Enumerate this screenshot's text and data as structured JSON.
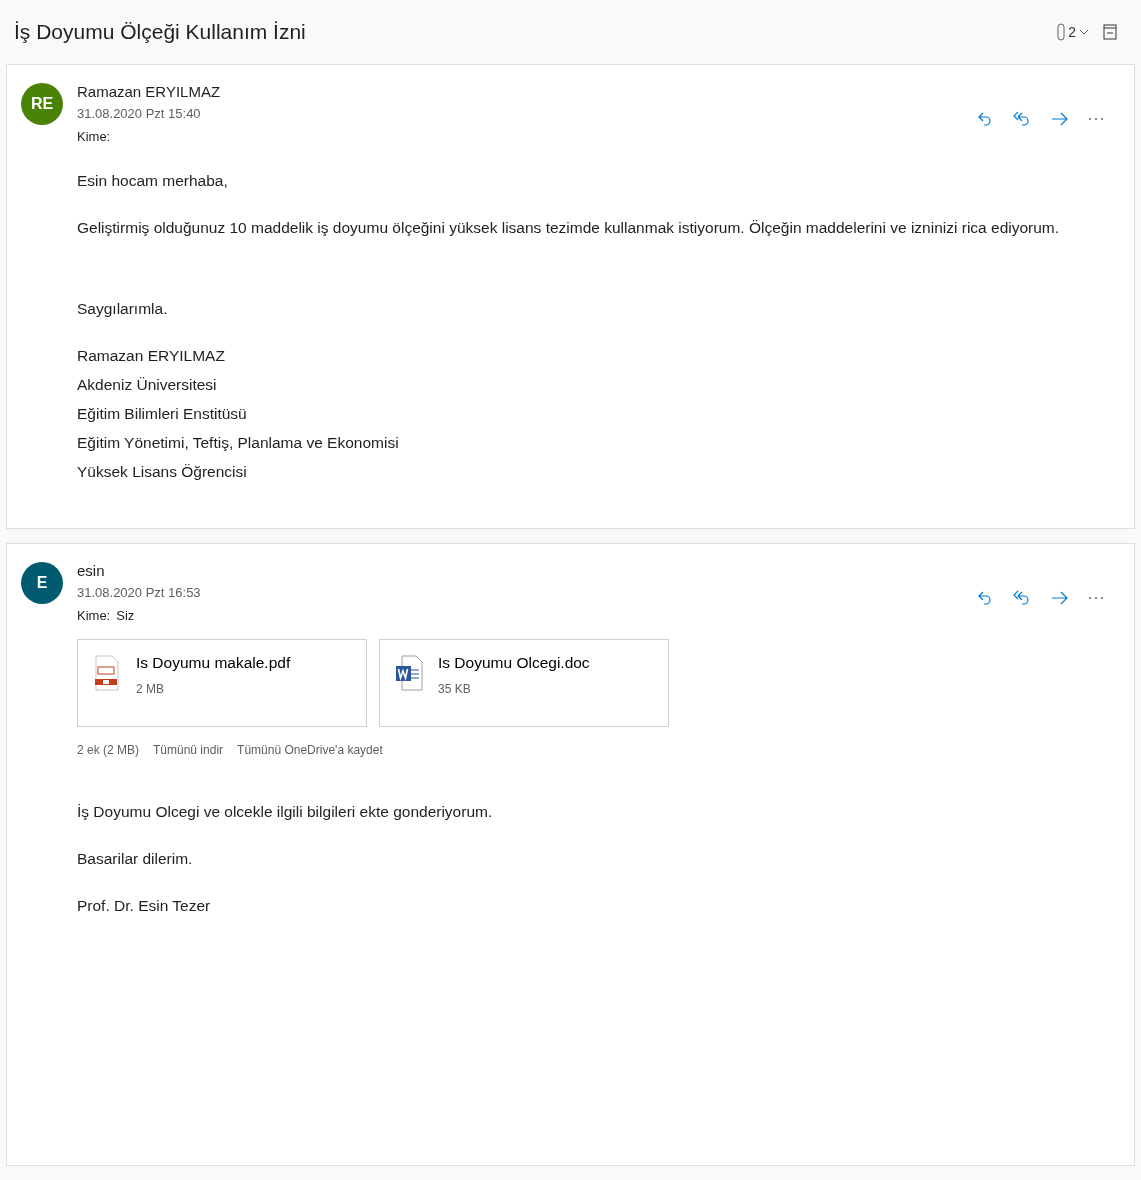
{
  "subject": "İş Doyumu Ölçeği Kullanım İzni",
  "header": {
    "attachment_count": "2"
  },
  "messages": [
    {
      "avatar": {
        "initials": "RE",
        "color": "#498205"
      },
      "sender": "Ramazan ERYILMAZ",
      "date": "31.08.2020 Pzt 15:40",
      "to_label": "Kime:",
      "paragraphs": [
        [
          "Esin hocam merhaba,"
        ],
        [
          "Geliştirmiş olduğunuz 10 maddelik iş doyumu ölçeğini yüksek lisans tezimde kullanmak istiyorum.  Ölçeğin maddelerini ve izninizi rica ediyorum."
        ],
        [
          "Saygılarımla."
        ],
        [
          "Ramazan ERYILMAZ",
          "Akdeniz Üniversitesi",
          "Eğitim Bilimleri Enstitüsü",
          "Eğitim Yönetimi, Teftiş, Planlama ve Ekonomisi",
          "Yüksek Lisans Öğrencisi"
        ]
      ]
    },
    {
      "avatar": {
        "initials": "E",
        "color": "#005b70"
      },
      "sender": "esin",
      "date": "31.08.2020 Pzt 16:53",
      "to_label": "Kime:",
      "to": "Siz",
      "attachments": [
        {
          "kind": "pdf",
          "name": "Is Doyumu makale.pdf",
          "size": "2 MB"
        },
        {
          "kind": "word",
          "name": "Is Doyumu Olcegi.doc",
          "size": "35 KB"
        }
      ],
      "attachment_actions": {
        "summary": "2 ek (2 MB)",
        "download": "Tümünü indir",
        "save": "Tümünü OneDrive'a kaydet"
      },
      "paragraphs": [
        [
          "İş Doyumu Olcegi ve olcekle ilgili bilgileri ekte gonderiyorum."
        ],
        [
          "Basarilar dilerim."
        ],
        [
          "Prof. Dr. Esin Tezer"
        ]
      ]
    }
  ]
}
